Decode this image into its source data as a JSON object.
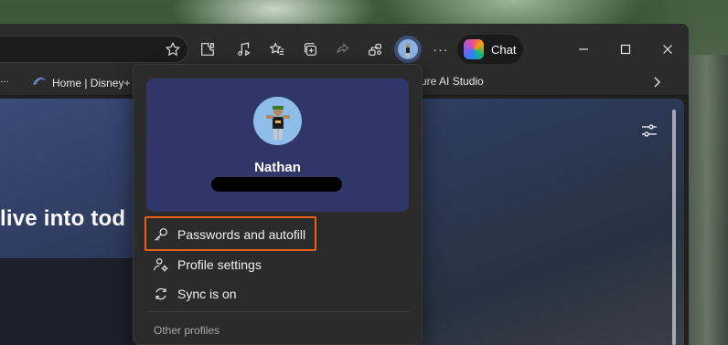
{
  "toolbar": {
    "more_label": "···",
    "chat_label": "Chat"
  },
  "favorites": {
    "items": [
      {
        "label": "Home | Disney+"
      },
      {
        "label": "zure AI Studio"
      }
    ],
    "overflow_icon": "chevron-right-icon"
  },
  "page": {
    "hero_text": "live into tod"
  },
  "profile_menu": {
    "name": "Nathan",
    "items": [
      {
        "label": "Passwords and autofill",
        "icon": "key-icon",
        "highlighted": true
      },
      {
        "label": "Profile settings",
        "icon": "person-gear-icon"
      },
      {
        "label": "Sync is on",
        "icon": "sync-icon"
      }
    ],
    "section_label": "Other profiles"
  },
  "colors": {
    "highlight": "#e8601c",
    "profile_card": "#313668",
    "flyout_bg": "#2b2b2b"
  }
}
